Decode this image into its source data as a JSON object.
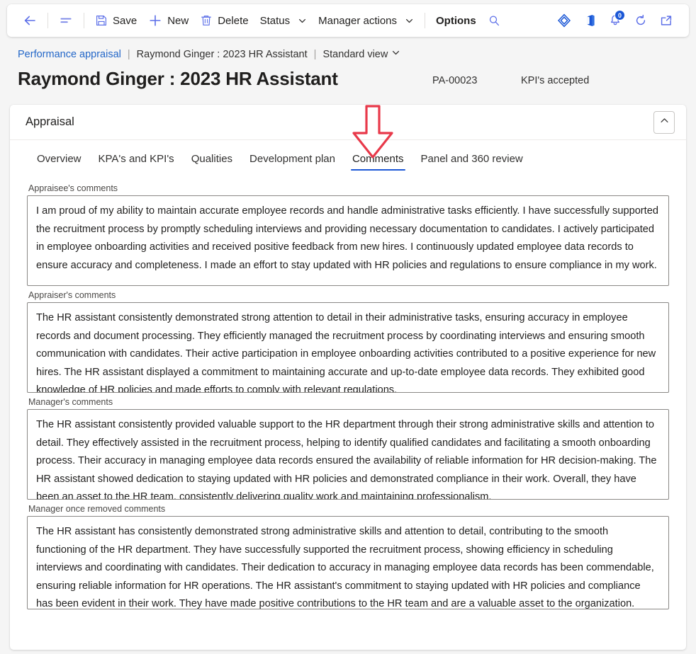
{
  "commandbar": {
    "back_label": "Back",
    "menu_label": "Show navigation",
    "save_label": "Save",
    "new_label": "New",
    "delete_label": "Delete",
    "status_label": "Status",
    "manager_actions_label": "Manager actions",
    "options_label": "Options",
    "search_label": "Search",
    "icons": {
      "back": "back-arrow-icon",
      "menu": "list-lines-icon",
      "save": "save-floppy-icon",
      "new": "plus-icon",
      "delete": "trash-icon",
      "status_chevron": "chevron-down-icon",
      "manager_chevron": "chevron-down-icon",
      "search": "search-icon",
      "dynamics": "dynamics-diamond-icon",
      "office": "office-app-icon",
      "notifications": "notification-bell-icon",
      "refresh": "refresh-icon",
      "popout": "open-in-new-icon"
    },
    "notification_count": "0",
    "accent_color": "#1b57d6",
    "icon_color": "#5b6ee8"
  },
  "breadcrumb": {
    "module": "Performance appraisal",
    "separator": "|",
    "record": "Raymond Ginger : 2023 HR Assistant",
    "view": "Standard view",
    "view_chevron": "chevron-down-icon"
  },
  "header": {
    "title": "Raymond Ginger : 2023 HR Assistant",
    "record_id": "PA-00023",
    "status": "KPI's accepted"
  },
  "card": {
    "title": "Appraisal",
    "collapse_icon": "chevron-up-icon",
    "tabs": [
      {
        "label": "Overview",
        "active": false
      },
      {
        "label": "KPA's and KPI's",
        "active": false
      },
      {
        "label": "Qualities",
        "active": false
      },
      {
        "label": "Development plan",
        "active": false
      },
      {
        "label": "Comments",
        "active": true
      },
      {
        "label": "Panel and 360 review",
        "active": false
      }
    ]
  },
  "annotation": {
    "type": "down-arrow",
    "color": "#e8394a",
    "points_to": "Comments"
  },
  "fields": [
    {
      "label": "Appraisee's comments",
      "name": "appraisee-comments",
      "value": "I am proud of my ability to maintain accurate employee records and handle administrative tasks efficiently. I have successfully supported the recruitment process by promptly scheduling interviews and providing necessary documentation to candidates. I actively participated in employee onboarding activities and received positive feedback from new hires. I continuously updated employee data records to ensure accuracy and completeness. I made an effort to stay updated with HR policies and regulations to ensure compliance in my work."
    },
    {
      "label": "Appraiser's comments",
      "name": "appraiser-comments",
      "value": "The HR assistant consistently demonstrated strong attention to detail in their administrative tasks, ensuring accuracy in employee records and document processing. They efficiently managed the recruitment process by coordinating interviews and ensuring smooth communication with candidates. Their active participation in employee onboarding activities contributed to a positive experience for new hires. The HR assistant displayed a commitment to maintaining accurate and up-to-date employee data records. They exhibited good knowledge of HR policies and made efforts to comply with relevant regulations."
    },
    {
      "label": "Manager's comments",
      "name": "manager-comments",
      "value": "The HR assistant consistently provided valuable support to the HR department through their strong administrative skills and attention to detail. They effectively assisted in the recruitment process, helping to identify qualified candidates and facilitating a smooth onboarding process. Their accuracy in managing employee data records ensured the availability of reliable information for HR decision-making. The HR assistant showed dedication to staying updated with HR policies and demonstrated compliance in their work. Overall, they have been an asset to the HR team, consistently delivering quality work and maintaining professionalism."
    },
    {
      "label": "Manager once removed comments",
      "name": "manager-once-removed-comments",
      "value": "The HR assistant has consistently demonstrated strong administrative skills and attention to detail, contributing to the smooth functioning of the HR department. They have successfully supported the recruitment process, showing efficiency in scheduling interviews and coordinating with candidates. Their dedication to accuracy in managing employee data records has been commendable, ensuring reliable information for HR operations. The HR assistant's commitment to staying updated with HR policies and compliance has been evident in their work. They have made positive contributions to the HR team and are a valuable asset to the organization."
    }
  ]
}
